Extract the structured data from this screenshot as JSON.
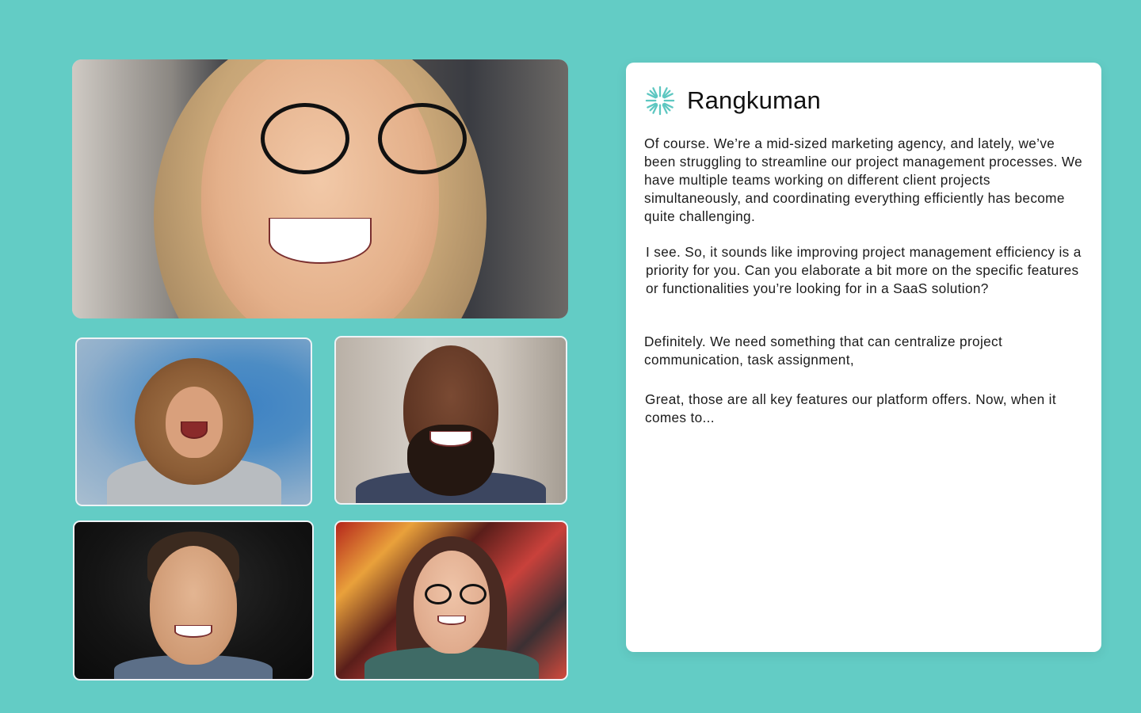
{
  "participants": [
    {
      "name": "participant-main",
      "description": "Smiling woman with glasses"
    },
    {
      "name": "participant-1",
      "description": "Laughing woman with curly hair"
    },
    {
      "name": "participant-2",
      "description": "Smiling bearded man"
    },
    {
      "name": "participant-3",
      "description": "Smiling young man"
    },
    {
      "name": "participant-4",
      "description": "Smiling woman with glasses"
    }
  ],
  "chat": {
    "brand_name": "Rangkuman",
    "brand_icon": "sparkle-logo-icon",
    "accent_color": "#5ec7c1",
    "messages": [
      {
        "text": "Of course. We’re a mid-sized marketing agency, and lately, we’ve been struggling to streamline our project management processes. We have multiple teams working on different client projects simultaneously, and coordinating everything efficiently has become quite challenging."
      },
      {
        "text": "I see. So, it sounds like improving project management efficiency is a priority for you. Can you elaborate a bit more on the specific features or functionalities you’re looking for in a SaaS solution?"
      },
      {
        "text": "Definitely. We need something that can centralize project communication, task assignment,"
      },
      {
        "text": "Great, those are all key features our platform offers. Now, when it comes to..."
      }
    ]
  },
  "colors": {
    "background": "#63ccc5",
    "card": "#ffffff"
  }
}
